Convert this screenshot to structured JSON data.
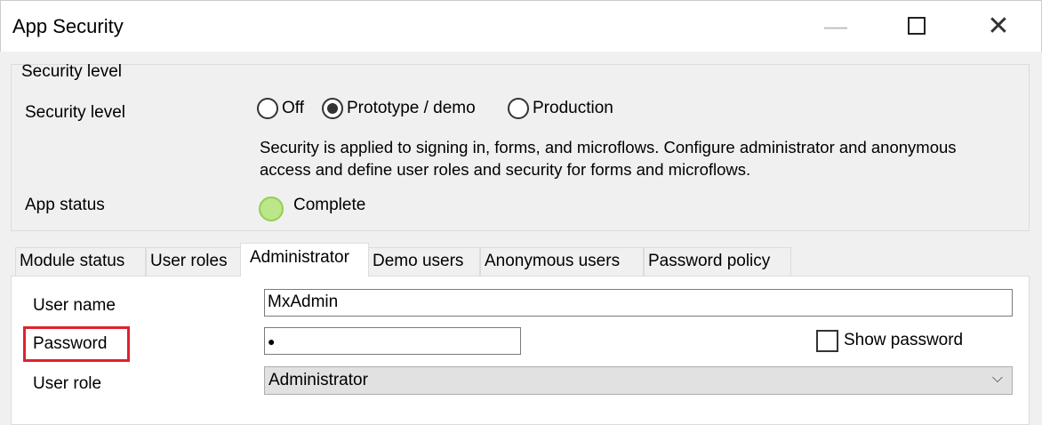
{
  "window": {
    "title": "App Security",
    "minimize_icon": "minimize-icon",
    "maximize_icon": "maximize-icon",
    "close_icon": "close-icon"
  },
  "security": {
    "group_title": "Security level",
    "level_label": "Security level",
    "options": [
      {
        "label": "Off",
        "selected": false
      },
      {
        "label": "Prototype / demo",
        "selected": true
      },
      {
        "label": "Production",
        "selected": false
      }
    ],
    "description": "Security is applied to signing in, forms, and microflows. Configure administrator and anonymous access and define user roles and security for forms and microflows.",
    "status_label": "App status",
    "status_value": "Complete",
    "status_color": "#bde589"
  },
  "tabs": [
    {
      "label": "Module status"
    },
    {
      "label": "User roles"
    },
    {
      "label": "Administrator",
      "active": true
    },
    {
      "label": "Demo users"
    },
    {
      "label": "Anonymous users"
    },
    {
      "label": "Password policy"
    }
  ],
  "admin": {
    "user_name_label": "User name",
    "user_name_value": "MxAdmin",
    "password_label": "Password",
    "password_value": "●",
    "show_password_label": "Show password",
    "show_password_checked": false,
    "user_role_label": "User role",
    "user_role_value": "Administrator"
  },
  "highlight_color": "#e1212e"
}
